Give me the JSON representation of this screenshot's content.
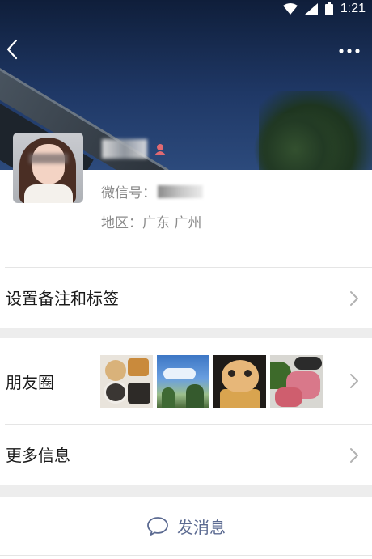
{
  "status_bar": {
    "time": "1:21"
  },
  "profile": {
    "name": "广居",
    "wechat_id_label": "微信号：",
    "wechat_id_value": "Weix…",
    "region": "地区：广东 广州",
    "gender_icon": "female-icon"
  },
  "rows": {
    "remark_label": "设置备注和标签",
    "moments_label": "朋友圈",
    "more_info_label": "更多信息"
  },
  "action": {
    "send_message_label": "发消息"
  },
  "colors": {
    "accent_link": "#5b6a91",
    "gender_female": "#e06a72",
    "divider": "#e5e5e5",
    "section_gap": "#ededed"
  }
}
